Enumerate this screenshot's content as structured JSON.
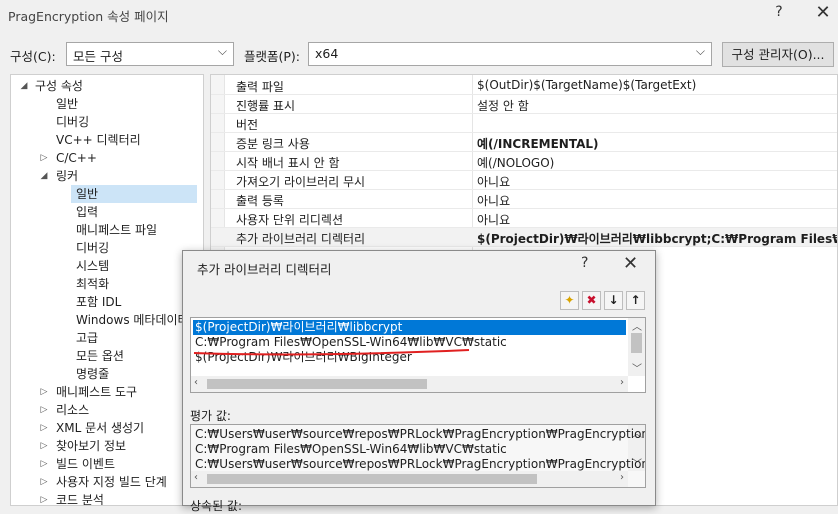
{
  "window": {
    "title": "PragEncryption 속성 페이지",
    "help_glyph": "?",
    "close_glyph": "✕"
  },
  "config_row": {
    "config_label": "구성(C):",
    "config_value": "모든 구성",
    "platform_label": "플랫폼(P):",
    "platform_value": "x64",
    "config_manager_button": "구성 관리자(O)..."
  },
  "tree": [
    {
      "label": "구성 속성",
      "toggle": "◢"
    },
    {
      "label": "일반"
    },
    {
      "label": "디버깅"
    },
    {
      "label": "VC++ 디렉터리"
    },
    {
      "label": "C/C++",
      "toggle": "▷"
    },
    {
      "label": "링커",
      "toggle": "◢"
    },
    {
      "label": "일반",
      "selected": true
    },
    {
      "label": "입력"
    },
    {
      "label": "매니페스트 파일"
    },
    {
      "label": "디버깅"
    },
    {
      "label": "시스템"
    },
    {
      "label": "최적화"
    },
    {
      "label": "포함 IDL"
    },
    {
      "label": "Windows 메타데이터"
    },
    {
      "label": "고급"
    },
    {
      "label": "모든 옵션"
    },
    {
      "label": "명령줄"
    },
    {
      "label": "매니페스트 도구",
      "toggle": "▷"
    },
    {
      "label": "리소스",
      "toggle": "▷"
    },
    {
      "label": "XML 문서 생성기",
      "toggle": "▷"
    },
    {
      "label": "찾아보기 정보",
      "toggle": "▷"
    },
    {
      "label": "빌드 이벤트",
      "toggle": "▷"
    },
    {
      "label": "사용자 지정 빌드 단계",
      "toggle": "▷"
    },
    {
      "label": "코드 분석",
      "toggle": "▷"
    }
  ],
  "properties": [
    {
      "name": "출력 파일",
      "value": "$(OutDir)$(TargetName)$(TargetExt)"
    },
    {
      "name": "진행률 표시",
      "value": "설정 안 함"
    },
    {
      "name": "버전",
      "value": ""
    },
    {
      "name": "증분 링크 사용",
      "value": "예(/INCREMENTAL)",
      "bold": true
    },
    {
      "name": "시작 배너 표시 안 함",
      "value": "예(/NOLOGO)"
    },
    {
      "name": "가져오기 라이브러리 무시",
      "value": "아니요"
    },
    {
      "name": "출력 등록",
      "value": "아니요"
    },
    {
      "name": "사용자 단위 리디렉션",
      "value": "아니요"
    },
    {
      "name": "추가 라이브러리 디렉터리",
      "value": "$(ProjectDir)₩라이브러리₩libbcrypt;C:₩Program Files₩OpenSSL",
      "bold": true
    }
  ],
  "dialog": {
    "title": "추가 라이브러리 디렉터리",
    "help_glyph": "?",
    "close_glyph": "✕",
    "toolbar": [
      {
        "icon": "new-folder-icon",
        "glyph": "✦",
        "color": "#d9a400"
      },
      {
        "icon": "delete-icon",
        "glyph": "✖",
        "color": "#c8102e"
      },
      {
        "icon": "move-down-icon",
        "glyph": "↓",
        "color": "#222222"
      },
      {
        "icon": "move-up-icon",
        "glyph": "↑",
        "color": "#222222"
      }
    ],
    "list_items": [
      "$(ProjectDir)₩라이브러리₩libbcrypt",
      "C:₩Program Files₩OpenSSL-Win64₩lib₩VC₩static",
      "$(ProjectDir)₩라이브러리₩BigInteger"
    ],
    "selected_index": 0,
    "evaluated_label": "평가 값:",
    "evaluated_lines": [
      "C:₩Users₩user₩source₩repos₩PRLock₩PragEncryption₩PragEncryption₩₩라이",
      "C:₩Program Files₩OpenSSL-Win64₩lib₩VC₩static",
      "C:₩Users₩user₩source₩repos₩PRLock₩PragEncryption₩PragEncryption₩₩라이"
    ],
    "inherited_label": "상속된 값:",
    "annotation_color": "#e02020"
  }
}
